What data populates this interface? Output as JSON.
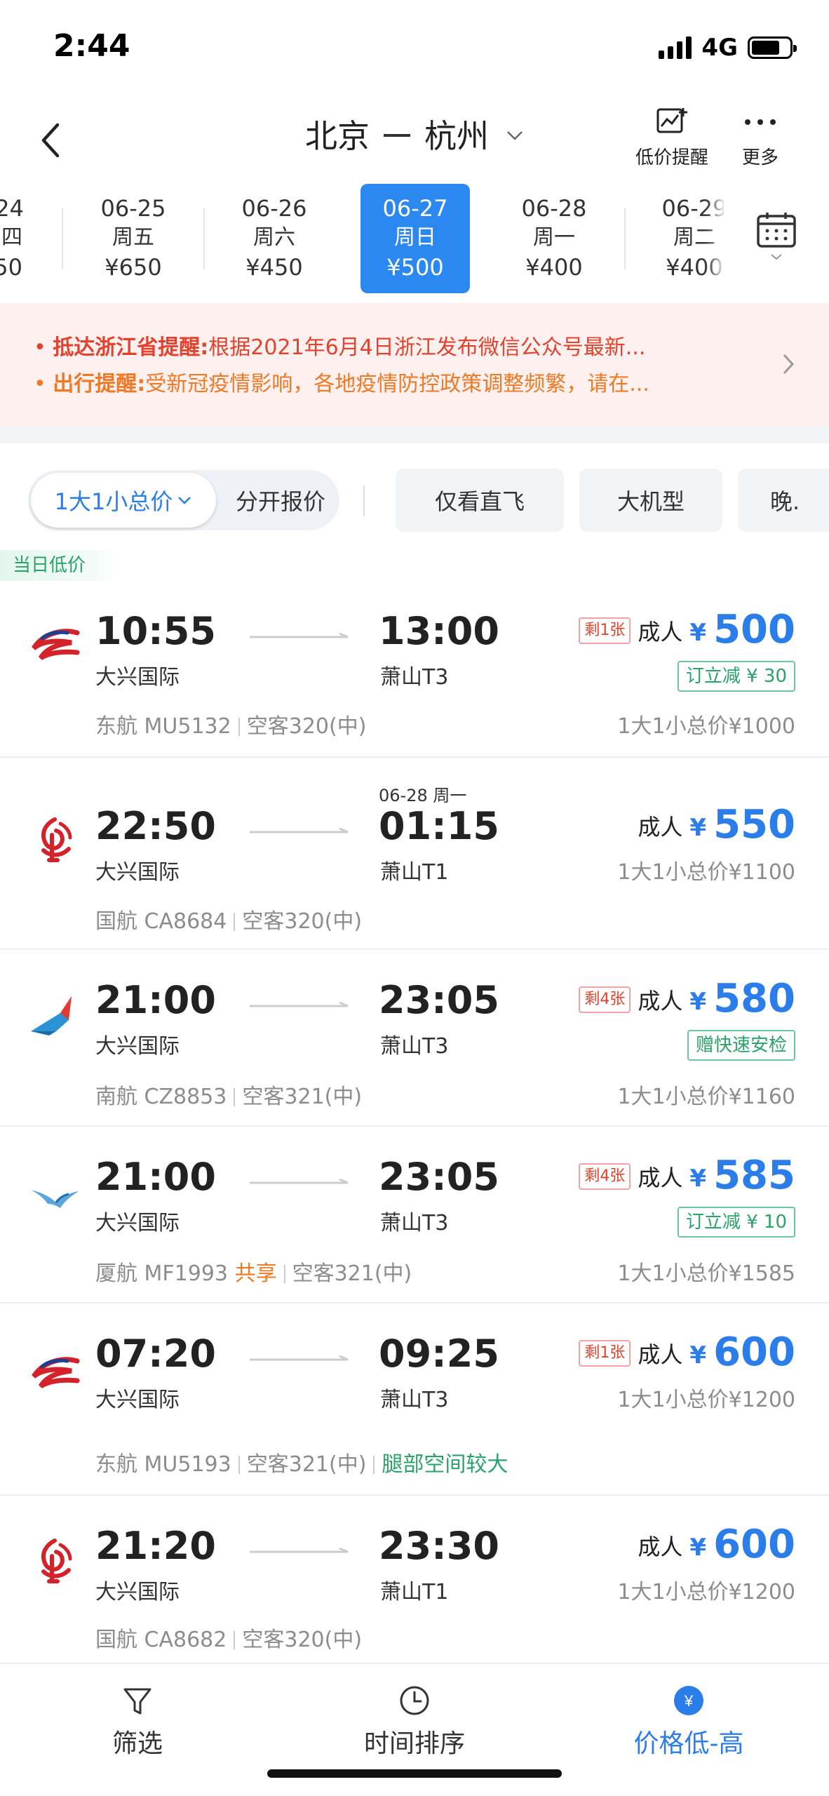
{
  "status_bar": {
    "time": "2:44",
    "network": "4G"
  },
  "nav": {
    "origin": "北京",
    "destination": "杭州",
    "price_alert_label": "低价提醒",
    "more_label": "更多"
  },
  "dates": [
    {
      "date": "24",
      "weekday": "四",
      "price": "50",
      "selected": false
    },
    {
      "date": "06-25",
      "weekday": "周五",
      "price": "¥650",
      "selected": false
    },
    {
      "date": "06-26",
      "weekday": "周六",
      "price": "¥450",
      "selected": false
    },
    {
      "date": "06-27",
      "weekday": "周日",
      "price": "¥500",
      "selected": true
    },
    {
      "date": "06-28",
      "weekday": "周一",
      "price": "¥400",
      "selected": false
    },
    {
      "date": "06-29",
      "weekday": "周二",
      "price": "¥400",
      "selected": false
    }
  ],
  "notices": [
    {
      "title": "抵达浙江省提醒:",
      "text": "根据2021年6月4日浙江发布微信公众号最新..."
    },
    {
      "title": "出行提醒:",
      "text": "受新冠疫情影响，各地疫情防控政策调整频繁，请在..."
    }
  ],
  "filters": {
    "total_price": "1大1小总价",
    "separate_price": "分开报价",
    "chips": [
      "仅看直飞",
      "大机型",
      "晚."
    ]
  },
  "lowest_tag": "当日低价",
  "flights": [
    {
      "airline_icon": "china-eastern-logo",
      "dep_time": "10:55",
      "dep_airport": "大兴国际",
      "arr_time": "13:00",
      "arr_airport": "萧山T3",
      "arr_day_note": "",
      "airline": "东航 MU5132",
      "share": "",
      "aircraft": "空客320(中)",
      "extra": "",
      "tickets_left": "剩1张",
      "adult_label": "成人",
      "currency": "¥",
      "price": "500",
      "promo": "订立减 ¥ 30",
      "total": "1大1小总价¥1000"
    },
    {
      "airline_icon": "air-china-logo",
      "dep_time": "22:50",
      "dep_airport": "大兴国际",
      "arr_time": "01:15",
      "arr_airport": "萧山T1",
      "arr_day_note": "06-28 周一",
      "airline": "国航 CA8684",
      "share": "",
      "aircraft": "空客320(中)",
      "extra": "",
      "tickets_left": "",
      "adult_label": "成人",
      "currency": "¥",
      "price": "550",
      "promo": "",
      "total": "1大1小总价¥1100"
    },
    {
      "airline_icon": "china-southern-logo",
      "dep_time": "21:00",
      "dep_airport": "大兴国际",
      "arr_time": "23:05",
      "arr_airport": "萧山T3",
      "arr_day_note": "",
      "airline": "南航 CZ8853",
      "share": "",
      "aircraft": "空客321(中)",
      "extra": "",
      "tickets_left": "剩4张",
      "adult_label": "成人",
      "currency": "¥",
      "price": "580",
      "promo": "赠快速安检",
      "total": "1大1小总价¥1160"
    },
    {
      "airline_icon": "xiamen-airlines-logo",
      "dep_time": "21:00",
      "dep_airport": "大兴国际",
      "arr_time": "23:05",
      "arr_airport": "萧山T3",
      "arr_day_note": "",
      "airline": "厦航 MF1993",
      "share": "共享",
      "aircraft": "空客321(中)",
      "extra": "",
      "tickets_left": "剩4张",
      "adult_label": "成人",
      "currency": "¥",
      "price": "585",
      "promo": "订立减 ¥ 10",
      "total": "1大1小总价¥1585"
    },
    {
      "airline_icon": "china-eastern-logo",
      "dep_time": "07:20",
      "dep_airport": "大兴国际",
      "arr_time": "09:25",
      "arr_airport": "萧山T3",
      "arr_day_note": "",
      "airline": "东航 MU5193",
      "share": "",
      "aircraft": "空客321(中)",
      "extra": "腿部空间较大",
      "tickets_left": "剩1张",
      "adult_label": "成人",
      "currency": "¥",
      "price": "600",
      "promo": "",
      "total": "1大1小总价¥1200"
    },
    {
      "airline_icon": "air-china-logo",
      "dep_time": "21:20",
      "dep_airport": "大兴国际",
      "arr_time": "23:30",
      "arr_airport": "萧山T1",
      "arr_day_note": "",
      "airline": "国航 CA8682",
      "share": "",
      "aircraft": "空客320(中)",
      "extra": "",
      "tickets_left": "",
      "adult_label": "成人",
      "currency": "¥",
      "price": "600",
      "promo": "",
      "total": "1大1小总价¥1200"
    }
  ],
  "tabbar": {
    "filter": "筛选",
    "time_sort": "时间排序",
    "price_sort": "价格低-高"
  },
  "colors": {
    "accent": "#2b88f0",
    "price": "#2b7de9",
    "alert_red": "#e2432f",
    "alert_orange": "#ee7a26",
    "green": "#29a36a"
  }
}
